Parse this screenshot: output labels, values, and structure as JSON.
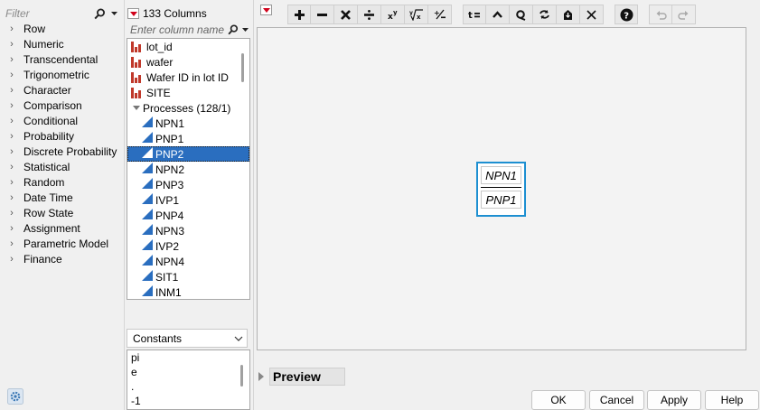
{
  "functions": {
    "filter_placeholder": "Filter",
    "categories": [
      "Row",
      "Numeric",
      "Transcendental",
      "Trigonometric",
      "Character",
      "Comparison",
      "Conditional",
      "Probability",
      "Discrete Probability",
      "Statistical",
      "Random",
      "Date Time",
      "Row State",
      "Assignment",
      "Parametric Model",
      "Finance"
    ]
  },
  "columns": {
    "count_label": "133 Columns",
    "search_placeholder": "Enter column name",
    "group_label": "Processes (128/1)",
    "items": [
      {
        "label": "lot_id",
        "type": "nominal"
      },
      {
        "label": "wafer",
        "type": "nominal"
      },
      {
        "label": "Wafer ID in lot ID",
        "type": "nominal"
      },
      {
        "label": "SITE",
        "type": "nominal"
      },
      {
        "label": "NPN1",
        "type": "continuous"
      },
      {
        "label": "PNP1",
        "type": "continuous"
      },
      {
        "label": "PNP2",
        "type": "continuous",
        "selected": true
      },
      {
        "label": "NPN2",
        "type": "continuous"
      },
      {
        "label": "PNP3",
        "type": "continuous"
      },
      {
        "label": "IVP1",
        "type": "continuous"
      },
      {
        "label": "PNP4",
        "type": "continuous"
      },
      {
        "label": "NPN3",
        "type": "continuous"
      },
      {
        "label": "IVP2",
        "type": "continuous"
      },
      {
        "label": "NPN4",
        "type": "continuous"
      },
      {
        "label": "SIT1",
        "type": "continuous"
      },
      {
        "label": "INM1",
        "type": "continuous"
      }
    ]
  },
  "constants": {
    "selected": "Constants",
    "items": [
      "pi",
      "e",
      ".",
      "-1"
    ]
  },
  "toolbar": {
    "buttons": [
      {
        "name": "plus",
        "glyph": "+"
      },
      {
        "name": "minus",
        "glyph": "−"
      },
      {
        "name": "multiply",
        "glyph": "✕"
      },
      {
        "name": "divide",
        "glyph": "÷"
      },
      {
        "name": "power",
        "glyph": "xʸ"
      },
      {
        "name": "root",
        "glyph": "ʸ√x"
      },
      {
        "name": "negate",
        "glyph": "+/−"
      },
      {
        "name": "assign",
        "glyph": "t="
      },
      {
        "name": "raise",
        "glyph": "^"
      },
      {
        "name": "peel",
        "glyph": "↺"
      },
      {
        "name": "swap",
        "glyph": "⇄"
      },
      {
        "name": "unthrow",
        "glyph": "⌂"
      },
      {
        "name": "delete",
        "glyph": "✕"
      },
      {
        "name": "help",
        "glyph": "?"
      },
      {
        "name": "undo",
        "glyph": "↶"
      },
      {
        "name": "redo",
        "glyph": "↷"
      }
    ]
  },
  "formula": {
    "numerator": "NPN1",
    "denominator": "PNP1"
  },
  "preview": {
    "label": "Preview"
  },
  "buttons": {
    "ok": "OK",
    "cancel": "Cancel",
    "apply": "Apply",
    "help": "Help"
  },
  "colors": {
    "selection": "#2a6ebf",
    "formula_border": "#1d8fd1",
    "menu_triangle": "#d0021b",
    "nominal_icon": "#c0392b"
  }
}
